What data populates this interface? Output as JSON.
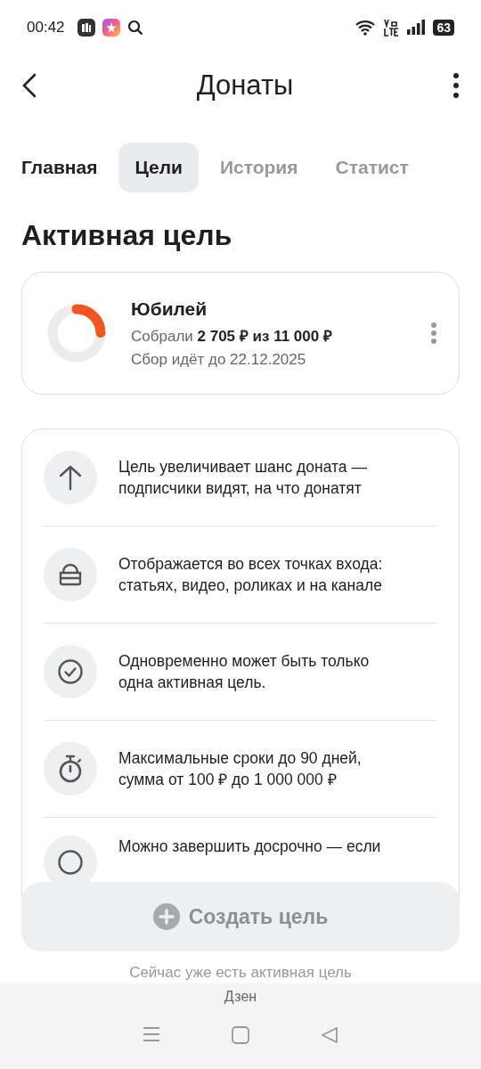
{
  "status_bar": {
    "time": "00:42",
    "battery": "63"
  },
  "header": {
    "title": "Донаты"
  },
  "tabs": [
    {
      "label": "Главная",
      "selected": false
    },
    {
      "label": "Цели",
      "selected": true
    },
    {
      "label": "История",
      "selected": false
    },
    {
      "label": "Статист",
      "selected": false
    }
  ],
  "section_title": "Активная цель",
  "goal": {
    "name": "Юбилей",
    "progress": "Собрали **2 705 ₽ из 11 000 ₽**",
    "deadline": "Сбор идёт до 22.12.2025",
    "level": 0.246
  },
  "info_items": [
    {
      "kind": "arrow",
      "text": "Цель увеличивает шанс доната — подписчики видят, на что донатят"
    },
    {
      "kind": "stack",
      "text": "Отображается во всех точках входа: статьях, видео, роликах и на канале"
    },
    {
      "kind": "check",
      "text": "Одновременно может быть только одна активная цель."
    },
    {
      "kind": "timer",
      "text": "Максимальные сроки до 90 дней, сумма от 100 ₽ до 1 000 000 ₽"
    },
    {
      "kind": "circle",
      "text": "Можно завершить досрочно — если"
    }
  ],
  "create_button": {
    "label": "Создать цель",
    "disabled": true
  },
  "note": "Сейчас уже есть активная цель",
  "bottom_bar": {
    "app_name": "Дзен"
  }
}
